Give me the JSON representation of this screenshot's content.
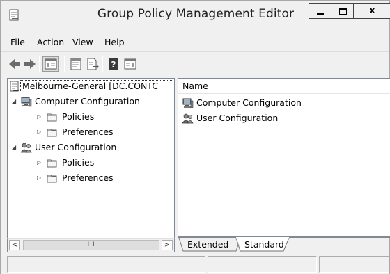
{
  "window": {
    "title": "Group Policy Management Editor",
    "close_glyph": "x"
  },
  "menu": {
    "file": "File",
    "action": "Action",
    "view": "View",
    "help": "Help"
  },
  "tree": {
    "root": "Melbourne-General [DC.CONTC",
    "computer_config": "Computer Configuration",
    "computer_policies": "Policies",
    "computer_preferences": "Preferences",
    "user_config": "User Configuration",
    "user_policies": "Policies",
    "user_preferences": "Preferences"
  },
  "scrollbar": {
    "left_arrow": "<",
    "right_arrow": ">",
    "thumb_grip": "III"
  },
  "list": {
    "column_name": "Name",
    "items": [
      "Computer Configuration",
      "User Configuration"
    ]
  },
  "tabs": {
    "extended": "Extended",
    "standard": "Standard",
    "active": "Standard"
  },
  "icons": {
    "app": "gpo-editor-icon",
    "back": "back-arrow-icon",
    "forward": "forward-arrow-icon",
    "show_hide_tree": "show-hide-console-tree-icon",
    "properties": "properties-icon",
    "export": "export-list-icon",
    "help": "help-icon",
    "show_action_pane": "show-action-pane-icon",
    "computer": "computer-icon",
    "user": "users-icon",
    "folder": "folder-icon"
  },
  "colors": {
    "window_bg": "#f0f0f0",
    "pane_bg": "#ffffff",
    "border": "#828790"
  }
}
